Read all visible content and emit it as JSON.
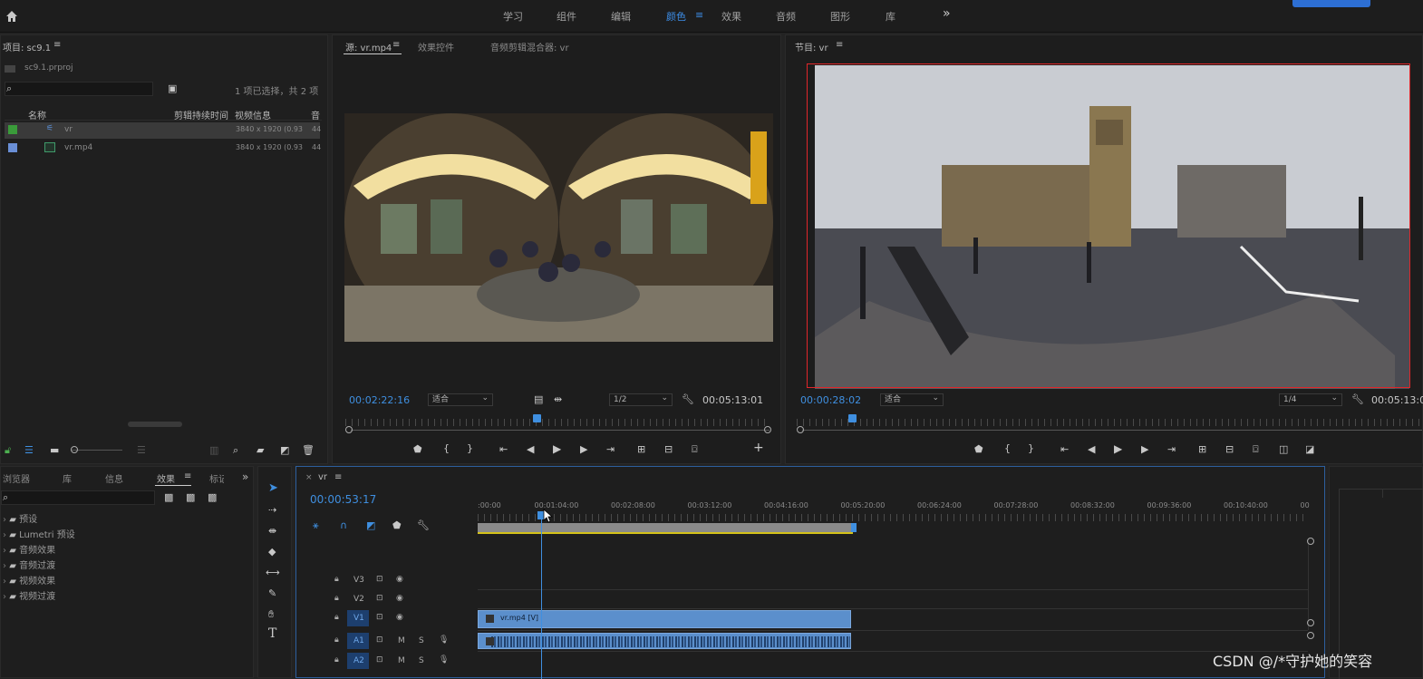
{
  "workspaces": [
    "学习",
    "组件",
    "编辑",
    "颜色",
    "效果",
    "音频",
    "图形",
    "库"
  ],
  "active_workspace": "颜色",
  "more_symbol": "»",
  "project": {
    "title": "项目: sc9.1",
    "file": "sc9.1.prproj",
    "selection": "1 项已选择，共 2 项",
    "columns": [
      "名称",
      "剪辑持续时间",
      "视频信息",
      "音"
    ],
    "items": [
      {
        "name": "vr",
        "info": "3840 x 1920 (0.93",
        "extra": "44",
        "color": "#3a9b3a"
      },
      {
        "name": "vr.mp4",
        "info": "3840 x 1920 (0.93",
        "extra": "44",
        "color": "#6a8fd6"
      }
    ]
  },
  "source": {
    "tabs": [
      "源: vr.mp4",
      "效果控件",
      "音频剪辑混合器: vr"
    ],
    "timecode": "00:02:22:16",
    "fit": "适合",
    "res": "1/2",
    "duration": "00:05:13:01"
  },
  "program": {
    "title": "节目: vr",
    "timecode": "00:00:28:02",
    "fit": "适合",
    "res": "1/4",
    "duration": "00:05:13:0"
  },
  "effects_panel": {
    "tabs": [
      "浏览器",
      "库",
      "信息",
      "效果",
      "标记"
    ],
    "tree": [
      "预设",
      "Lumetri 预设",
      "音频效果",
      "音频过渡",
      "视频效果",
      "视频过渡"
    ]
  },
  "timeline": {
    "name": "vr",
    "timecode": "00:00:53:17",
    "ruler": [
      ":00:00",
      "00:01:04:00",
      "00:02:08:00",
      "00:03:12:00",
      "00:04:16:00",
      "00:05:20:00",
      "00:06:24:00",
      "00:07:28:00",
      "00:08:32:00",
      "00:09:36:00",
      "00:10:40:00",
      "00"
    ],
    "tracks": [
      "V3",
      "V2",
      "V1",
      "A1",
      "A2"
    ],
    "clip": "vr.mp4 [V]"
  },
  "watermark": "CSDN @/*守护她的笑容",
  "colors": {
    "accent": "#3f8fe0",
    "clip": "#5b8fcc",
    "selected_frame": "#e0262a"
  }
}
